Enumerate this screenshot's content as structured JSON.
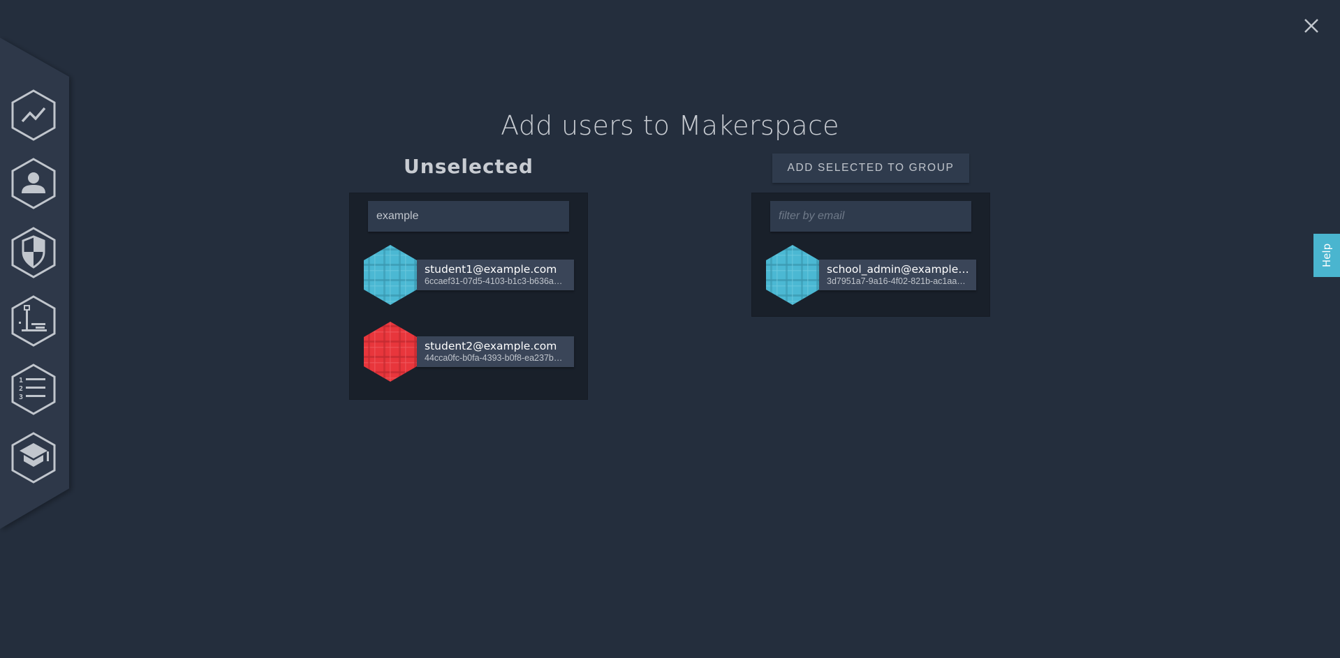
{
  "page": {
    "title": "Add users to Makerspace",
    "close_icon": "close-icon",
    "help_label": "Help"
  },
  "colors": {
    "background": "#242e3d",
    "sidebar": "#2d384a",
    "panel": "#19202a",
    "input": "#2f3b4d",
    "card": "#3a4558",
    "help_accent": "#4ab5cf",
    "avatar_blue": "#4bb8d3",
    "avatar_red": "#e8363c"
  },
  "sidebar": {
    "items": [
      {
        "name": "analytics",
        "icon": "chart-line-icon"
      },
      {
        "name": "users",
        "icon": "user-icon"
      },
      {
        "name": "security",
        "icon": "shield-icon"
      },
      {
        "name": "equipment",
        "icon": "machine-icon"
      },
      {
        "name": "lists",
        "icon": "numbered-list-icon"
      },
      {
        "name": "training",
        "icon": "graduation-cap-icon"
      }
    ]
  },
  "unselected": {
    "heading": "Unselected",
    "filter_value": "example",
    "filter_placeholder": "filter by email",
    "users": [
      {
        "email": "student1@example.com",
        "id": "6ccaef31-07d5-4103-b1c3-b636a…",
        "avatar_color": "blue"
      },
      {
        "email": "student2@example.com",
        "id": "44cca0fc-b0fa-4393-b0f8-ea237b…",
        "avatar_color": "red"
      }
    ]
  },
  "selected": {
    "button_label": "ADD SELECTED TO GROUP",
    "filter_value": "",
    "filter_placeholder": "filter by email",
    "users": [
      {
        "email": "school_admin@example…",
        "id": "3d7951a7-9a16-4f02-821b-ac1aa…",
        "avatar_color": "blue"
      }
    ]
  }
}
